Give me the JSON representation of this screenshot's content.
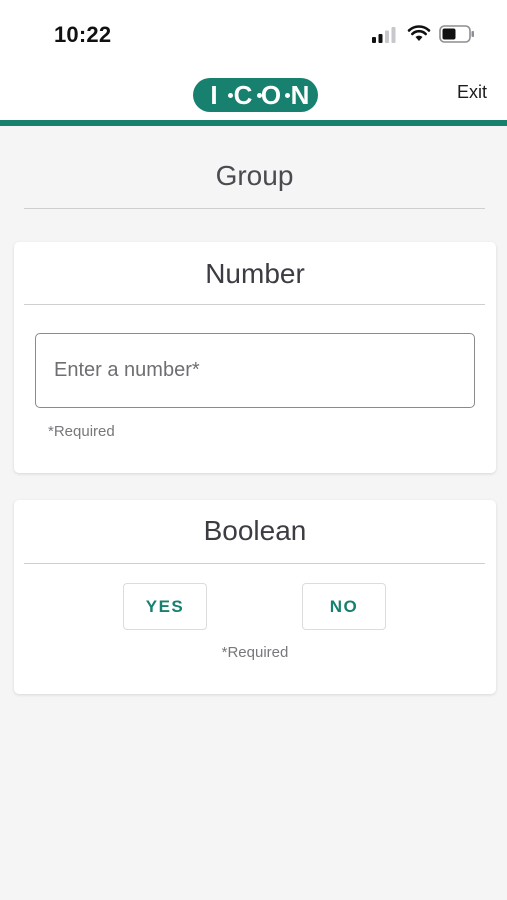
{
  "status_bar": {
    "time": "10:22"
  },
  "header": {
    "logo_letters": [
      "I",
      "C",
      "O",
      "N"
    ],
    "brand_color": "#17806e",
    "exit_label": "Exit"
  },
  "group": {
    "title": "Group"
  },
  "number_card": {
    "title": "Number",
    "input_placeholder": "Enter a number*",
    "input_value": "",
    "required_label": "*Required"
  },
  "boolean_card": {
    "title": "Boolean",
    "yes_label": "YES",
    "no_label": "NO",
    "required_label": "*Required"
  }
}
